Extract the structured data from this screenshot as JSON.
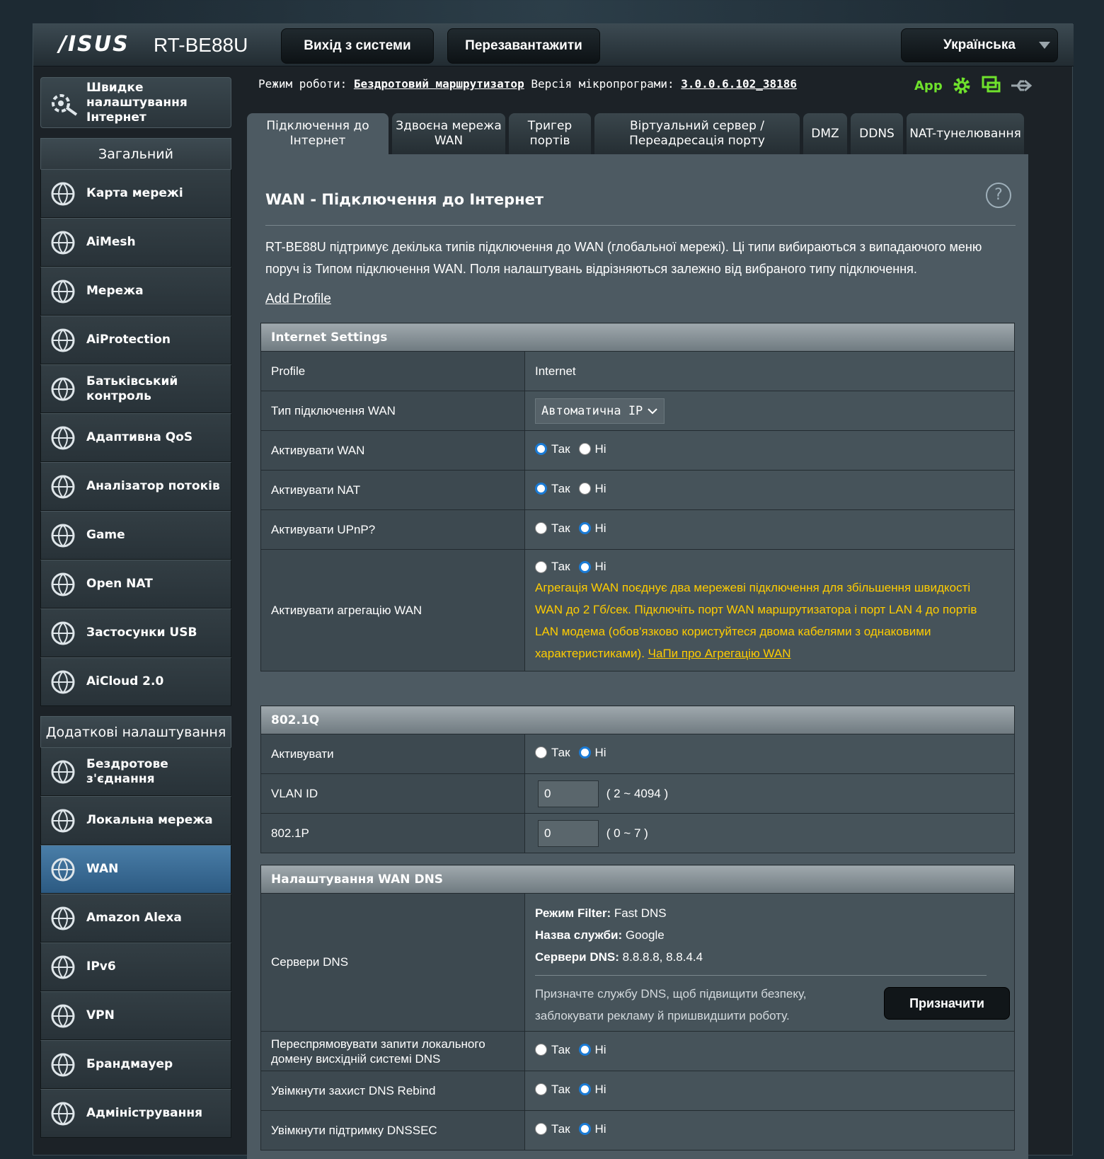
{
  "header": {
    "brand": "/ISUS",
    "model": "RT-BE88U",
    "logout_label": "Вихід з системи",
    "reboot_label": "Перезавантажити",
    "language": "Українська"
  },
  "status": {
    "mode_label": "Режим роботи:",
    "mode_value": "Бездротовий маршрутизатор",
    "firmware_label": "Версія мікропрограми:",
    "firmware_value": "3.0.0.6.102_38186",
    "app_label": "App"
  },
  "sidebar": {
    "quick_setup": "Швидке налаштування Інтернет",
    "general_title": "Загальний",
    "general_items": [
      {
        "label": "Карта мережі",
        "icon": "network-map-icon"
      },
      {
        "label": "AiMesh",
        "icon": "aimesh-icon"
      },
      {
        "label": "Мережа",
        "icon": "guest-network-icon"
      },
      {
        "label": "AiProtection",
        "icon": "shield-icon"
      },
      {
        "label": "Батьківський контроль",
        "icon": "parental-control-icon"
      },
      {
        "label": "Адаптивна QoS",
        "icon": "speedometer-icon"
      },
      {
        "label": "Аналізатор потоків",
        "icon": "traffic-analyzer-icon"
      },
      {
        "label": "Game",
        "icon": "gamepad-icon"
      },
      {
        "label": "Open NAT",
        "icon": "open-nat-icon"
      },
      {
        "label": "Застосунки USB",
        "icon": "usb-icon"
      },
      {
        "label": "AiCloud 2.0",
        "icon": "cloud-icon"
      }
    ],
    "advanced_title": "Додаткові налаштування",
    "advanced_items": [
      {
        "label": "Бездротове з'єднання",
        "icon": "wireless-icon"
      },
      {
        "label": "Локальна мережа",
        "icon": "lan-icon"
      },
      {
        "label": "WAN",
        "icon": "globe-icon",
        "active": true
      },
      {
        "label": "Amazon Alexa",
        "icon": "alexa-icon"
      },
      {
        "label": "IPv6",
        "icon": "ipv6-icon"
      },
      {
        "label": "VPN",
        "icon": "vpn-icon"
      },
      {
        "label": "Брандмауер",
        "icon": "firewall-icon"
      },
      {
        "label": "Адміністрування",
        "icon": "gear-icon"
      }
    ]
  },
  "tabs": [
    {
      "label": "Підключення до Інтернет",
      "active": true
    },
    {
      "label": "Здвоєна мережа WAN"
    },
    {
      "label": "Тригер портів"
    },
    {
      "label": "Віртуальний сервер / Переадресація порту"
    },
    {
      "label": "DMZ"
    },
    {
      "label": "DDNS"
    },
    {
      "label": "NAT-тунелювання"
    }
  ],
  "main": {
    "title": "WAN - Підключення до Інтернет",
    "description": "RT-BE88U підтримує декілька типів підключення до WAN (глобальної мережі). Ці типи вибираються з випадаючого меню поруч із Типом підключення WAN. Поля налаштувань відрізняються залежно від вибраного типу підключення.",
    "add_profile": "Add Profile",
    "yes": "Так",
    "no": "Ні"
  },
  "internet_settings": {
    "header": "Internet Settings",
    "profile_label": "Profile",
    "profile_value": "Internet",
    "wan_type_label": "Тип підключення WAN",
    "wan_type_value": "Автоматична IP",
    "enable_wan_label": "Активувати WAN",
    "enable_wan": "yes",
    "enable_nat_label": "Активувати NAT",
    "enable_nat": "yes",
    "enable_upnp_label": "Активувати UPnP?",
    "enable_upnp": "no",
    "aggregation_label": "Активувати агрегацію WAN",
    "aggregation": "no",
    "aggregation_note": "Агрегація WAN поєднує два мережеві підключення для збільшення швидкості WAN до 2 Гб/сек. Підключіть порт WAN маршрутизатора і порт LAN 4 до портів LAN модема (обов'язково користуйтеся двома кабелями з однаковими характеристиками).",
    "aggregation_faq": "ЧаПи про Агрегацію WAN"
  },
  "dot1q": {
    "header": "802.1Q",
    "enable_label": "Активувати",
    "enable": "no",
    "vlan_label": "VLAN ID",
    "vlan_value": "0",
    "vlan_hint": "( 2 ~ 4094 )",
    "prio_label": "802.1P",
    "prio_value": "0",
    "prio_hint": "( 0 ~ 7 )"
  },
  "dns": {
    "header": "Налаштування WAN DNS",
    "servers_label": "Сервери DNS",
    "filter_mode_label": "Режим Filter:",
    "filter_mode_value": "Fast DNS",
    "service_label": "Назва служби:",
    "service_value": "Google",
    "servers_key": "Сервери DNS:",
    "servers_value": "8.8.8.8, 8.8.4.4",
    "assign_note": "Призначте службу DNS, щоб підвищити безпеку, заблокувати рекламу й пришвидшити роботу.",
    "assign_button": "Призначити",
    "forward_label": "Переспрямовувати запити локального домену висхідній системі DNS",
    "forward": "no",
    "rebind_label": "Увімкнути захист DNS Rebind",
    "rebind": "no",
    "dnssec_label": "Увімкнути підтримку DNSSEC",
    "dnssec": "no"
  },
  "colors": {
    "accent": "#1a7bd6",
    "warning": "#ffcc00",
    "app_green": "#6fe22c"
  }
}
